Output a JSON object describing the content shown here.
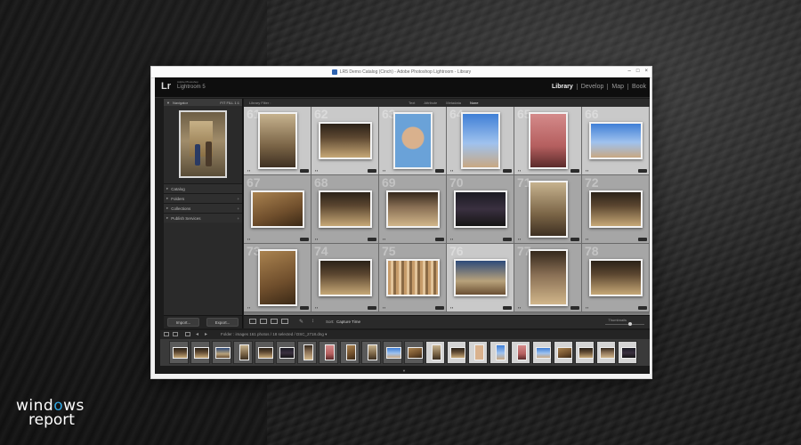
{
  "window": {
    "title": "LR5 Demo Catalog (Cinch) - Adobe Photoshop Lightroom - Library",
    "controls": [
      "–",
      "□",
      "×"
    ]
  },
  "lightroom": {
    "logo": "Lr",
    "adobe": "Adobe Photoshop",
    "product": "Lightroom 5",
    "modules": [
      {
        "label": "Library",
        "active": true
      },
      {
        "label": "Develop",
        "active": false
      },
      {
        "label": "Map",
        "active": false
      },
      {
        "label": "Book",
        "active": false
      }
    ]
  },
  "left_panel": {
    "navigator": "Navigator",
    "navigator_opts": "FIT  FILL  1:1",
    "sections": [
      "Catalog",
      "Folders",
      "Collections",
      "Publish Services"
    ],
    "buttons": {
      "import": "Import...",
      "export": "Export..."
    }
  },
  "filter_bar": {
    "label": "Library Filter :",
    "tabs": [
      {
        "label": "Text",
        "on": false
      },
      {
        "label": "Attribute",
        "on": false
      },
      {
        "label": "Metadata",
        "on": false
      },
      {
        "label": "None",
        "on": true
      }
    ]
  },
  "grid": {
    "cells": [
      {
        "idx": "61",
        "tone": "ph-door",
        "shape": "port",
        "bg": "light"
      },
      {
        "idx": "62",
        "tone": "ph-arena",
        "shape": "land",
        "bg": "light"
      },
      {
        "idx": "63",
        "tone": "ph-hat",
        "shape": "port",
        "bg": "light"
      },
      {
        "idx": "64",
        "tone": "ph-sky",
        "shape": "port",
        "bg": "light"
      },
      {
        "idx": "65",
        "tone": "ph-red",
        "shape": "port",
        "bg": "light"
      },
      {
        "idx": "66",
        "tone": "ph-sky",
        "shape": "land",
        "bg": "light"
      },
      {
        "idx": "67",
        "tone": "ph-warm",
        "shape": "land",
        "bg": "med"
      },
      {
        "idx": "68",
        "tone": "ph-arena",
        "shape": "land",
        "bg": "med"
      },
      {
        "idx": "69",
        "tone": "ph-barn",
        "shape": "land",
        "bg": "med"
      },
      {
        "idx": "70",
        "tone": "ph-dark",
        "shape": "land",
        "bg": "med"
      },
      {
        "idx": "71",
        "tone": "ph-door",
        "shape": "port",
        "bg": "med"
      },
      {
        "idx": "72",
        "tone": "ph-arena",
        "shape": "land",
        "bg": "med"
      },
      {
        "idx": "73",
        "tone": "ph-warm",
        "shape": "port",
        "bg": "med"
      },
      {
        "idx": "74",
        "tone": "ph-arena",
        "shape": "land",
        "bg": "med"
      },
      {
        "idx": "75",
        "tone": "ph-blur",
        "shape": "land",
        "bg": "med"
      },
      {
        "idx": "76",
        "tone": "ph-blue",
        "shape": "land",
        "bg": "light"
      },
      {
        "idx": "77",
        "tone": "ph-barn",
        "shape": "port",
        "bg": "med"
      },
      {
        "idx": "78",
        "tone": "ph-arena",
        "shape": "land",
        "bg": "med"
      }
    ]
  },
  "toolbar": {
    "sort_label": "Sort:",
    "sort_value": "Capture Time",
    "thumbnails": "Thumbnails"
  },
  "filmstrip": {
    "info": "Folder : images   161 photos / 18 selected / DSC_2718.dng ▾",
    "cells": [
      {
        "tone": "ph-arena",
        "shape": "land",
        "sel": false
      },
      {
        "tone": "ph-arena",
        "shape": "land",
        "sel": false
      },
      {
        "tone": "ph-blue",
        "shape": "land",
        "sel": false
      },
      {
        "tone": "ph-door",
        "shape": "port",
        "sel": false
      },
      {
        "tone": "ph-arena",
        "shape": "land",
        "sel": false
      },
      {
        "tone": "ph-dark",
        "shape": "land",
        "sel": false
      },
      {
        "tone": "ph-barn",
        "shape": "port",
        "sel": false
      },
      {
        "tone": "ph-red",
        "shape": "port",
        "sel": false
      },
      {
        "tone": "ph-warm",
        "shape": "port",
        "sel": false
      },
      {
        "tone": "ph-door",
        "shape": "port",
        "sel": false
      },
      {
        "tone": "ph-sky",
        "shape": "land",
        "sel": false
      },
      {
        "tone": "ph-warm",
        "shape": "land",
        "sel": false
      },
      {
        "tone": "ph-door",
        "shape": "port",
        "sel": true
      },
      {
        "tone": "ph-arena",
        "shape": "land",
        "sel": true
      },
      {
        "tone": "ph-hat",
        "shape": "port",
        "sel": true
      },
      {
        "tone": "ph-sky",
        "shape": "port",
        "sel": true
      },
      {
        "tone": "ph-red",
        "shape": "port",
        "sel": true
      },
      {
        "tone": "ph-sky",
        "shape": "land",
        "sel": true
      },
      {
        "tone": "ph-warm",
        "shape": "land",
        "sel": true
      },
      {
        "tone": "ph-arena",
        "shape": "land",
        "sel": true
      },
      {
        "tone": "ph-barn",
        "shape": "land",
        "sel": true
      },
      {
        "tone": "ph-dark",
        "shape": "land",
        "sel": true
      }
    ]
  },
  "branding": {
    "line1_a": "wind",
    "line1_b": "o",
    "line1_c": "ws",
    "line2": "report"
  }
}
